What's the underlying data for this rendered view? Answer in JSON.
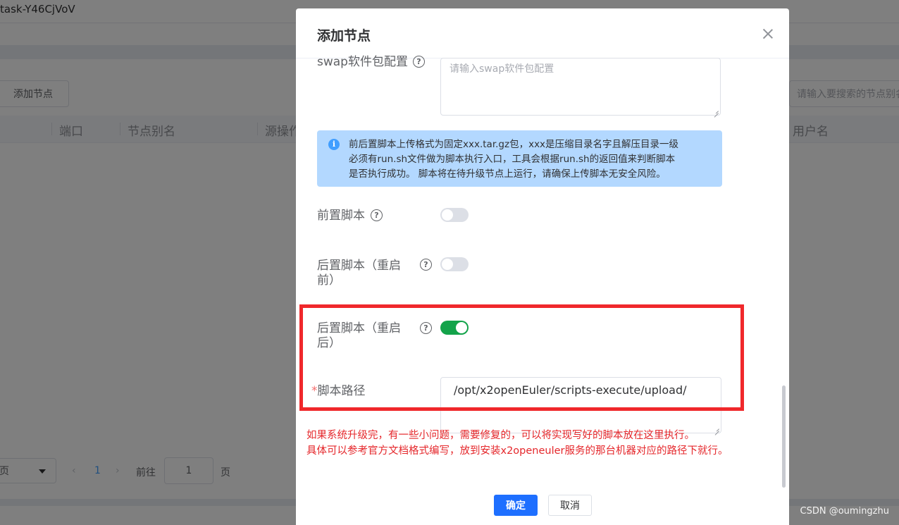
{
  "background": {
    "task_name": "task-Y46CjVoV",
    "add_node_button": "添加节点",
    "search_placeholder": "请输入要搜索的节点别名",
    "columns": [
      "端口",
      "节点别名",
      "源操作",
      "用户名"
    ],
    "pager": {
      "size_label": "页",
      "current_page": "1",
      "goto_label": "前往",
      "goto_value": "1",
      "page_suffix": "页"
    }
  },
  "dialog": {
    "title": "添加节点",
    "swap": {
      "label": "swap软件包配置",
      "placeholder": "请输入swap软件包配置"
    },
    "alert_lines": [
      "前后置脚本上传格式为固定xxx.tar.gz包，xxx是压缩目录名字且解压目录一级",
      "必须有run.sh文件做为脚本执行入口，工具会根据run.sh的返回值来判断脚本",
      "是否执行成功。 脚本将在待升级节点上运行，请确保上传脚本无安全风险。"
    ],
    "pre_script": {
      "label": "前置脚本",
      "enabled": false
    },
    "post_before_reboot": {
      "label_line1": "后置脚本（重启",
      "label_line2": "前）",
      "enabled": false
    },
    "post_after_reboot": {
      "label_line1": "后置脚本（重启",
      "label_line2": "后）",
      "enabled": true
    },
    "script_path": {
      "required_mark": "*",
      "label": "脚本路径",
      "value": "/opt/x2openEuler/scripts-execute/upload/"
    },
    "confirm_button": "确定",
    "cancel_button": "取消"
  },
  "annotation": {
    "line1": "如果系统升级完，有一些小问题，需要修复的，可以将实现写好的脚本放在这里执行。",
    "line2": "具体可以参考官方文档格式编写，放到安装x2openeuler服务的那台机器对应的路径下就行。",
    "highlight_color": "#f0282b"
  },
  "watermark": "CSDN @oumingzhu",
  "colors": {
    "primary": "#1e6fff",
    "switch_on": "#13a34a",
    "alert_bg": "#b3d8ff",
    "annotation_text": "#e5272b"
  }
}
